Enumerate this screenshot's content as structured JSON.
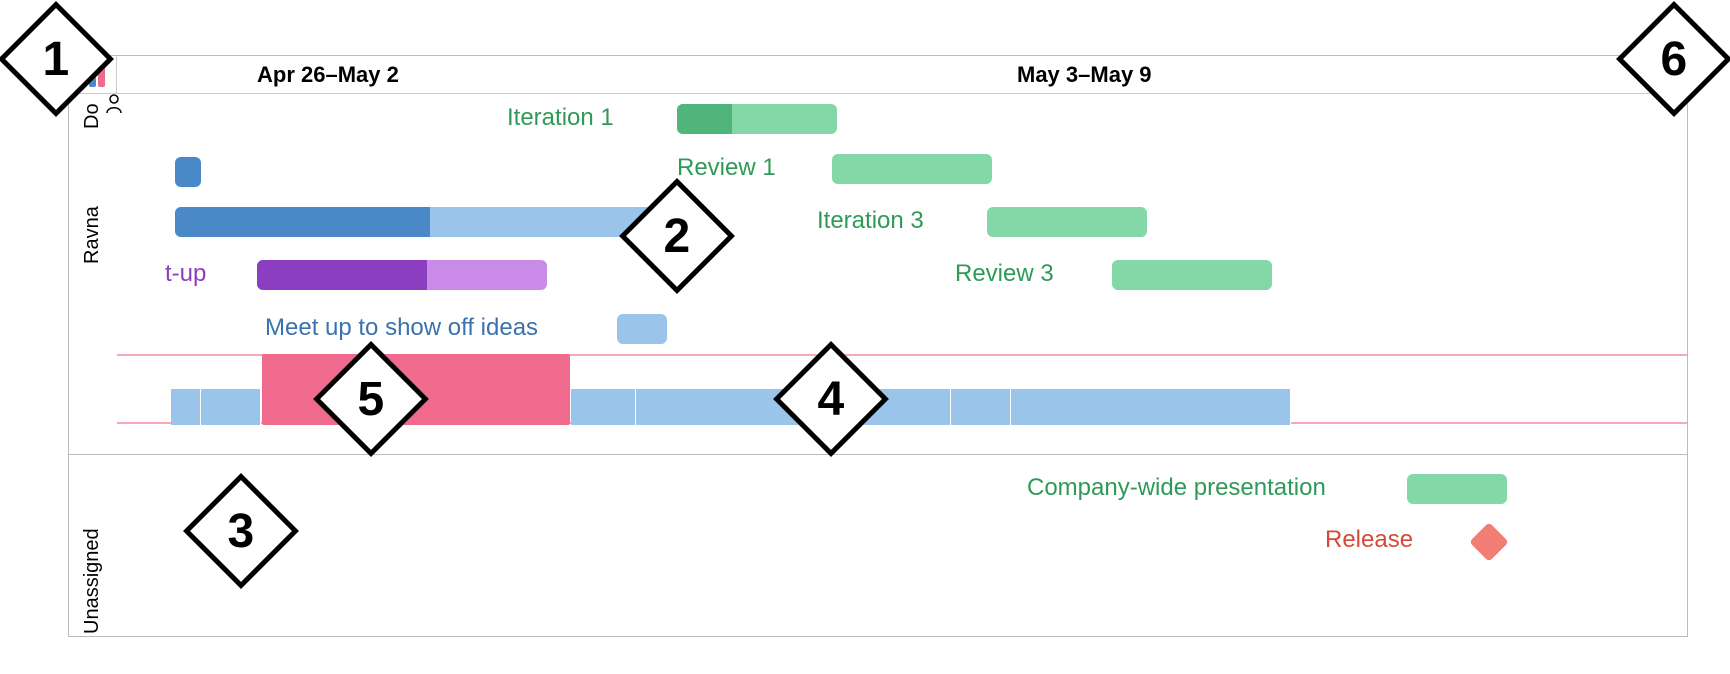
{
  "weeks": [
    "Apr 26–May 2",
    "May 3–May 9"
  ],
  "assignees": {
    "ravna": "Ravna",
    "do": "Do",
    "unassigned": "Unassigned"
  },
  "tasks": {
    "iteration1": {
      "label": "Iteration 1",
      "color_light": "#84d8a7",
      "color_dark": "#4fb57a"
    },
    "review1": {
      "label": "Review 1",
      "color_light": "#84d8a7"
    },
    "iteration3": {
      "label": "Iteration 3",
      "color_light": "#84d8a7"
    },
    "review3": {
      "label": "Review 3",
      "color_light": "#84d8a7"
    },
    "bluebar": {
      "color_light": "#9bc4ea",
      "color_dark": "#4a88c7"
    },
    "smallblue": {
      "color": "#4a88c7"
    },
    "setup": {
      "label": "t-up",
      "color_light": "#c98ae8",
      "color_dark": "#8b3fc0"
    },
    "meetup": {
      "label": "Meet up to show off ideas",
      "color": "#9bc4ea"
    },
    "presentation": {
      "label": "Company-wide presentation",
      "color": "#84d8a7",
      "label_color": "#2f9a57"
    },
    "release": {
      "label": "Release",
      "color": "#f27d75",
      "label_color": "#d44a38"
    }
  },
  "zoom_label": "+",
  "callouts": [
    "1",
    "2",
    "3",
    "4",
    "5",
    "6"
  ],
  "colors": {
    "green_text": "#2f9a57",
    "blue_text": "#3a72ad",
    "purple_text": "#8b3fc0",
    "pink": "#f06a8d",
    "strip_blue": "#9bc4ea"
  }
}
